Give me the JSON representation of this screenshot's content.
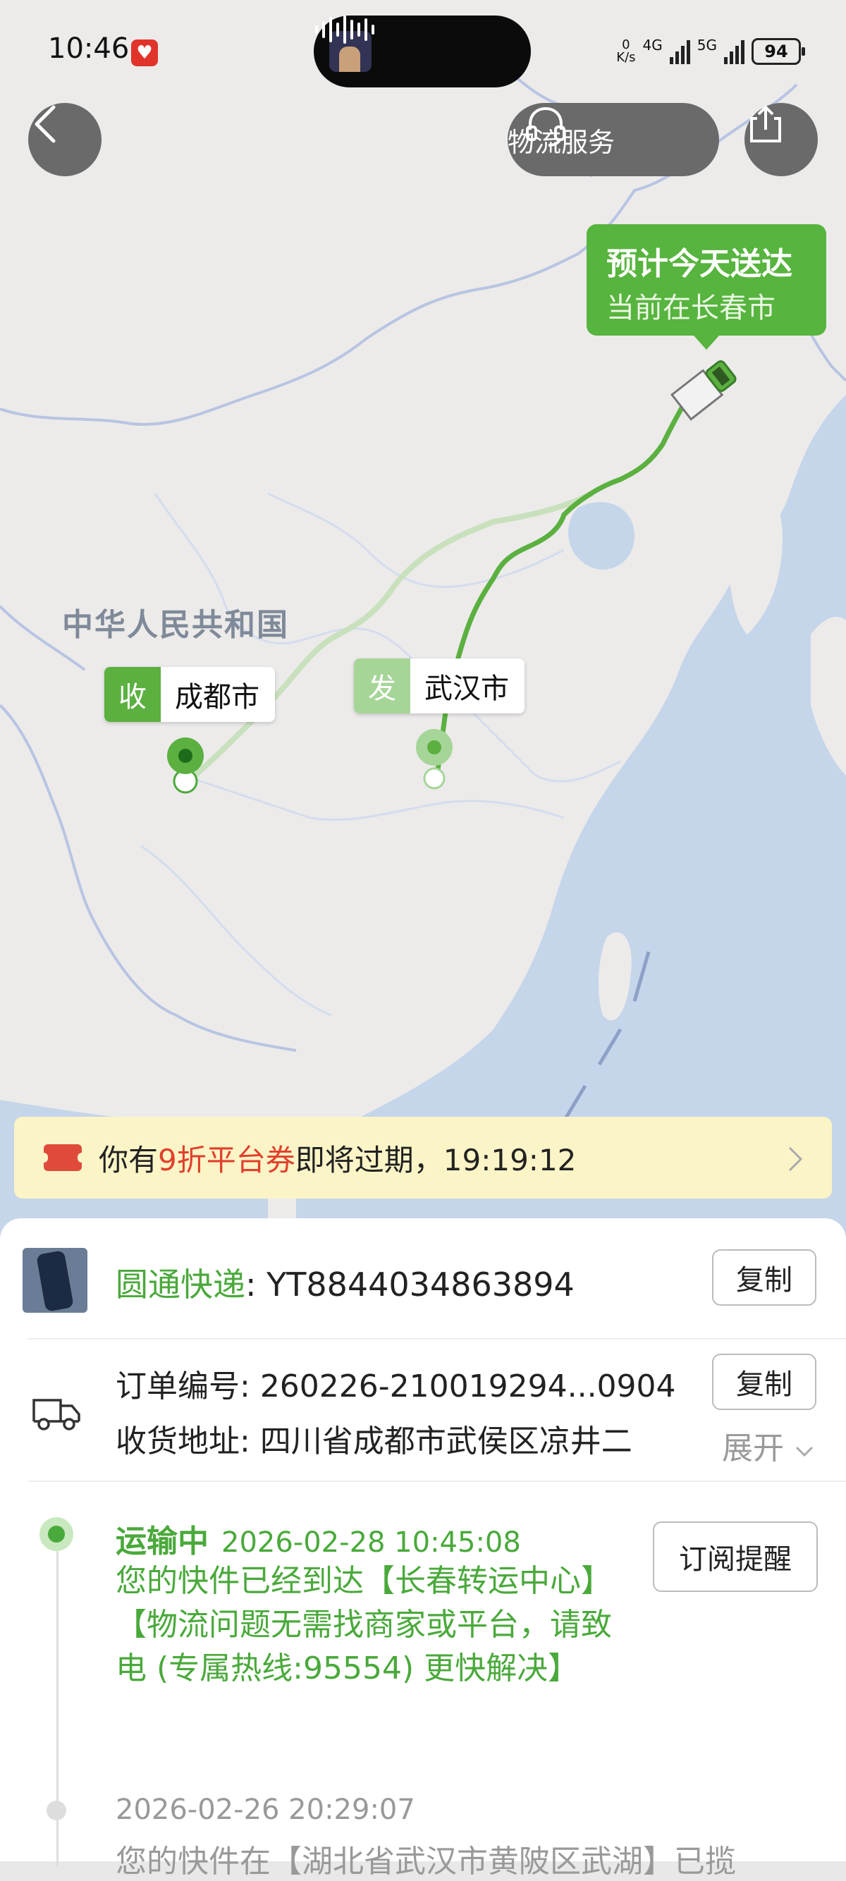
{
  "status_bar": {
    "time": "10:46",
    "net_speed_value": "0",
    "net_speed_unit": "K/s",
    "net_4g": "4G",
    "net_5g": "5G",
    "battery": "94"
  },
  "map_header": {
    "service_label": "物流服务",
    "back_icon": "chevron-left-icon",
    "share_icon": "share-icon",
    "headset_icon": "headset-icon"
  },
  "eta": {
    "title": "预计今天送达",
    "subtitle": "当前在长春市"
  },
  "map": {
    "country_label": "中华人民共和国",
    "destination": {
      "badge": "收",
      "city": "成都市"
    },
    "origin": {
      "badge": "发",
      "city": "武汉市"
    }
  },
  "coupon": {
    "prefix": "你有",
    "highlight": "9折平台券",
    "suffix": "即将过期，19:19:12"
  },
  "shipment": {
    "courier_name": "圆通快递",
    "courier_sep": ": ",
    "tracking_no": "YT8844034863894",
    "copy_label": "复制",
    "order_label": "订单编号: ",
    "order_no": "260226-210019294...0904",
    "address_label": "收货地址: ",
    "address": "四川省成都市武侯区凉井二",
    "expand_label": "展开"
  },
  "timeline": {
    "subscribe_label": "订阅提醒",
    "events": [
      {
        "state": "运输中",
        "time": "2026-02-28 10:45:08",
        "desc": "您的快件已经到达【长春转运中心】【物流问题无需找商家或平台，请致电 (专属热线:95554) 更快解决】"
      },
      {
        "time": "2026-02-26 20:29:07",
        "desc": "您的快件在【湖北省武汉市黄陂区武湖】已揽"
      }
    ]
  },
  "colors": {
    "accent_green": "#57b43e",
    "text_green": "#4aa93b",
    "coupon_bg": "#fbf4c7",
    "coupon_highlight": "#e0402c"
  }
}
